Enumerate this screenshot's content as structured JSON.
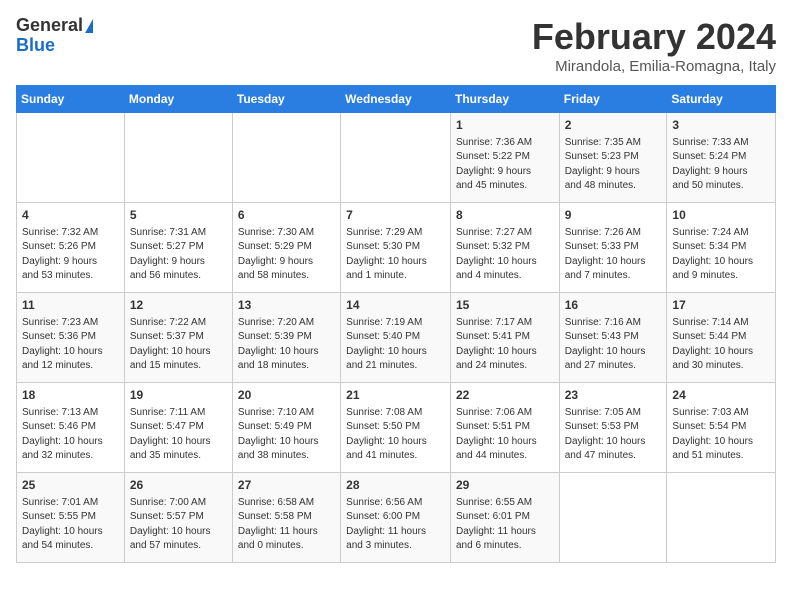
{
  "logo": {
    "general": "General",
    "blue": "Blue"
  },
  "header": {
    "title": "February 2024",
    "subtitle": "Mirandola, Emilia-Romagna, Italy"
  },
  "days_of_week": [
    "Sunday",
    "Monday",
    "Tuesday",
    "Wednesday",
    "Thursday",
    "Friday",
    "Saturday"
  ],
  "weeks": [
    [
      {
        "day": "",
        "detail": ""
      },
      {
        "day": "",
        "detail": ""
      },
      {
        "day": "",
        "detail": ""
      },
      {
        "day": "",
        "detail": ""
      },
      {
        "day": "1",
        "detail": "Sunrise: 7:36 AM\nSunset: 5:22 PM\nDaylight: 9 hours\nand 45 minutes."
      },
      {
        "day": "2",
        "detail": "Sunrise: 7:35 AM\nSunset: 5:23 PM\nDaylight: 9 hours\nand 48 minutes."
      },
      {
        "day": "3",
        "detail": "Sunrise: 7:33 AM\nSunset: 5:24 PM\nDaylight: 9 hours\nand 50 minutes."
      }
    ],
    [
      {
        "day": "4",
        "detail": "Sunrise: 7:32 AM\nSunset: 5:26 PM\nDaylight: 9 hours\nand 53 minutes."
      },
      {
        "day": "5",
        "detail": "Sunrise: 7:31 AM\nSunset: 5:27 PM\nDaylight: 9 hours\nand 56 minutes."
      },
      {
        "day": "6",
        "detail": "Sunrise: 7:30 AM\nSunset: 5:29 PM\nDaylight: 9 hours\nand 58 minutes."
      },
      {
        "day": "7",
        "detail": "Sunrise: 7:29 AM\nSunset: 5:30 PM\nDaylight: 10 hours\nand 1 minute."
      },
      {
        "day": "8",
        "detail": "Sunrise: 7:27 AM\nSunset: 5:32 PM\nDaylight: 10 hours\nand 4 minutes."
      },
      {
        "day": "9",
        "detail": "Sunrise: 7:26 AM\nSunset: 5:33 PM\nDaylight: 10 hours\nand 7 minutes."
      },
      {
        "day": "10",
        "detail": "Sunrise: 7:24 AM\nSunset: 5:34 PM\nDaylight: 10 hours\nand 9 minutes."
      }
    ],
    [
      {
        "day": "11",
        "detail": "Sunrise: 7:23 AM\nSunset: 5:36 PM\nDaylight: 10 hours\nand 12 minutes."
      },
      {
        "day": "12",
        "detail": "Sunrise: 7:22 AM\nSunset: 5:37 PM\nDaylight: 10 hours\nand 15 minutes."
      },
      {
        "day": "13",
        "detail": "Sunrise: 7:20 AM\nSunset: 5:39 PM\nDaylight: 10 hours\nand 18 minutes."
      },
      {
        "day": "14",
        "detail": "Sunrise: 7:19 AM\nSunset: 5:40 PM\nDaylight: 10 hours\nand 21 minutes."
      },
      {
        "day": "15",
        "detail": "Sunrise: 7:17 AM\nSunset: 5:41 PM\nDaylight: 10 hours\nand 24 minutes."
      },
      {
        "day": "16",
        "detail": "Sunrise: 7:16 AM\nSunset: 5:43 PM\nDaylight: 10 hours\nand 27 minutes."
      },
      {
        "day": "17",
        "detail": "Sunrise: 7:14 AM\nSunset: 5:44 PM\nDaylight: 10 hours\nand 30 minutes."
      }
    ],
    [
      {
        "day": "18",
        "detail": "Sunrise: 7:13 AM\nSunset: 5:46 PM\nDaylight: 10 hours\nand 32 minutes."
      },
      {
        "day": "19",
        "detail": "Sunrise: 7:11 AM\nSunset: 5:47 PM\nDaylight: 10 hours\nand 35 minutes."
      },
      {
        "day": "20",
        "detail": "Sunrise: 7:10 AM\nSunset: 5:49 PM\nDaylight: 10 hours\nand 38 minutes."
      },
      {
        "day": "21",
        "detail": "Sunrise: 7:08 AM\nSunset: 5:50 PM\nDaylight: 10 hours\nand 41 minutes."
      },
      {
        "day": "22",
        "detail": "Sunrise: 7:06 AM\nSunset: 5:51 PM\nDaylight: 10 hours\nand 44 minutes."
      },
      {
        "day": "23",
        "detail": "Sunrise: 7:05 AM\nSunset: 5:53 PM\nDaylight: 10 hours\nand 47 minutes."
      },
      {
        "day": "24",
        "detail": "Sunrise: 7:03 AM\nSunset: 5:54 PM\nDaylight: 10 hours\nand 51 minutes."
      }
    ],
    [
      {
        "day": "25",
        "detail": "Sunrise: 7:01 AM\nSunset: 5:55 PM\nDaylight: 10 hours\nand 54 minutes."
      },
      {
        "day": "26",
        "detail": "Sunrise: 7:00 AM\nSunset: 5:57 PM\nDaylight: 10 hours\nand 57 minutes."
      },
      {
        "day": "27",
        "detail": "Sunrise: 6:58 AM\nSunset: 5:58 PM\nDaylight: 11 hours\nand 0 minutes."
      },
      {
        "day": "28",
        "detail": "Sunrise: 6:56 AM\nSunset: 6:00 PM\nDaylight: 11 hours\nand 3 minutes."
      },
      {
        "day": "29",
        "detail": "Sunrise: 6:55 AM\nSunset: 6:01 PM\nDaylight: 11 hours\nand 6 minutes."
      },
      {
        "day": "",
        "detail": ""
      },
      {
        "day": "",
        "detail": ""
      }
    ]
  ]
}
